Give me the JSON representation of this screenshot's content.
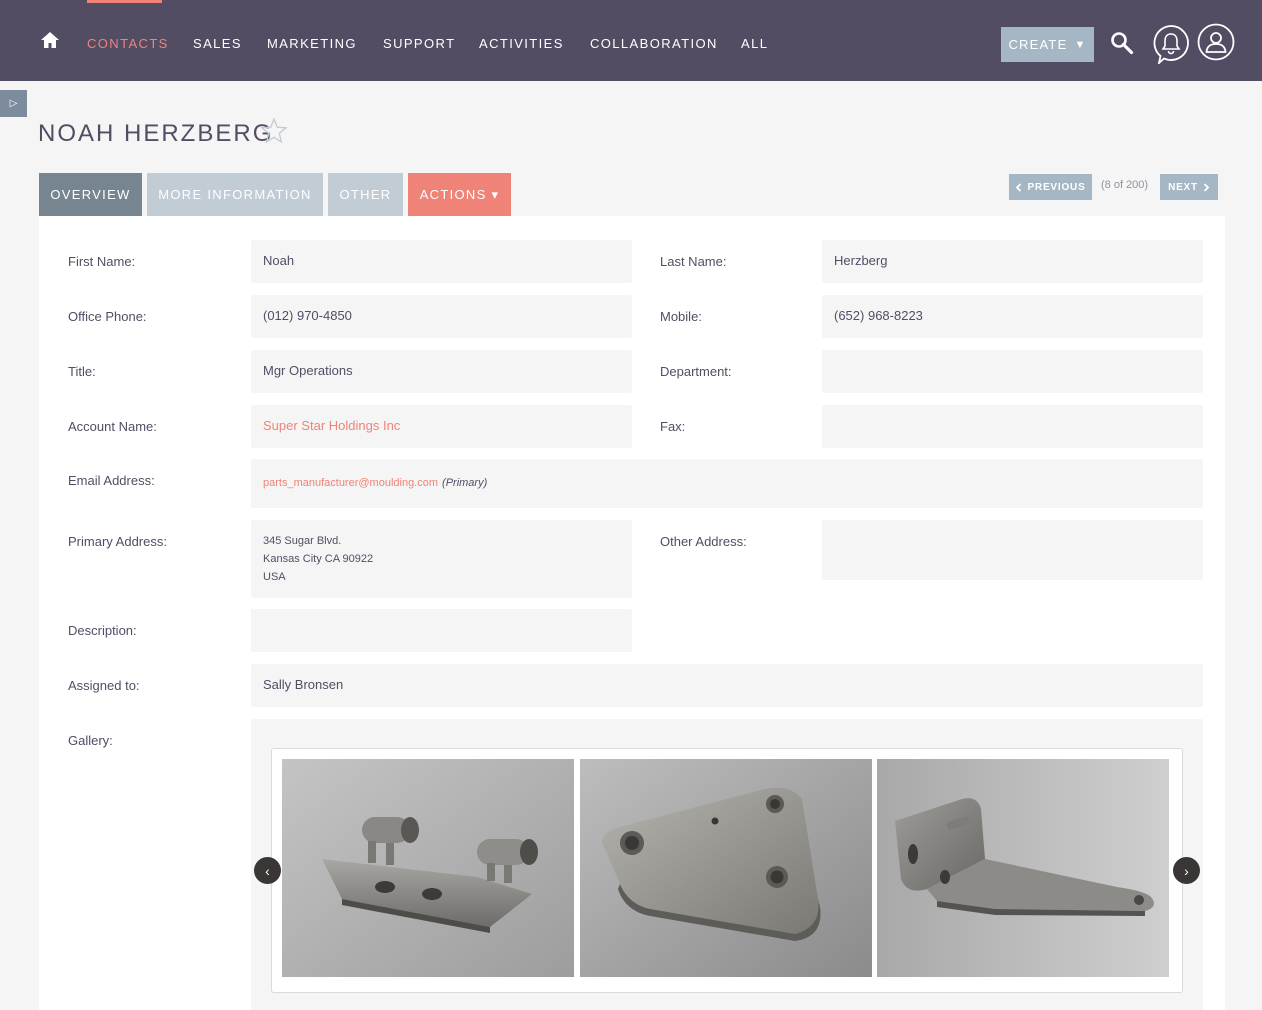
{
  "nav": {
    "items": [
      "CONTACTS",
      "SALES",
      "MARKETING",
      "SUPPORT",
      "ACTIVITIES",
      "COLLABORATION",
      "ALL"
    ],
    "create_label": "CREATE",
    "create_caret": "▼",
    "colors": {
      "bar": "#534d64",
      "accent": "#f08377",
      "button": "#a5b6c4"
    }
  },
  "sidebar_toggle": "▷",
  "record": {
    "title": "NOAH HERZBERG"
  },
  "tabs": {
    "overview": "OVERVIEW",
    "more": "MORE INFORMATION",
    "other": "OTHER",
    "actions": "ACTIONS ▾"
  },
  "pager": {
    "previous": "PREVIOUS",
    "count": "(8 of 200)",
    "next": "NEXT"
  },
  "fields": {
    "first_name_label": "First Name:",
    "first_name": "Noah",
    "last_name_label": "Last Name:",
    "last_name": "Herzberg",
    "office_phone_label": "Office Phone:",
    "office_phone": "(012) 970-4850",
    "mobile_label": "Mobile:",
    "mobile": "(652) 968-8223",
    "title_label": "Title:",
    "title": "Mgr Operations",
    "department_label": "Department:",
    "department": "",
    "account_label": "Account Name:",
    "account": "Super Star Holdings Inc",
    "fax_label": "Fax:",
    "fax": "",
    "email_label": "Email Address:",
    "email": "parts_manufacturer@moulding.com",
    "email_tag": "(Primary)",
    "primary_address_label": "Primary Address:",
    "primary_address": [
      "345 Sugar Blvd.",
      "Kansas City CA  90922",
      "USA"
    ],
    "other_address_label": "Other Address:",
    "other_address": "",
    "description_label": "Description:",
    "description": "",
    "assigned_label": "Assigned to:",
    "assigned": "Sally Bronsen",
    "gallery_label": "Gallery:"
  },
  "gallery": {
    "prev": "‹",
    "next": "›",
    "photos": [
      "hinge-part-photo",
      "triangle-plate-photo",
      "bracket-photo"
    ]
  }
}
